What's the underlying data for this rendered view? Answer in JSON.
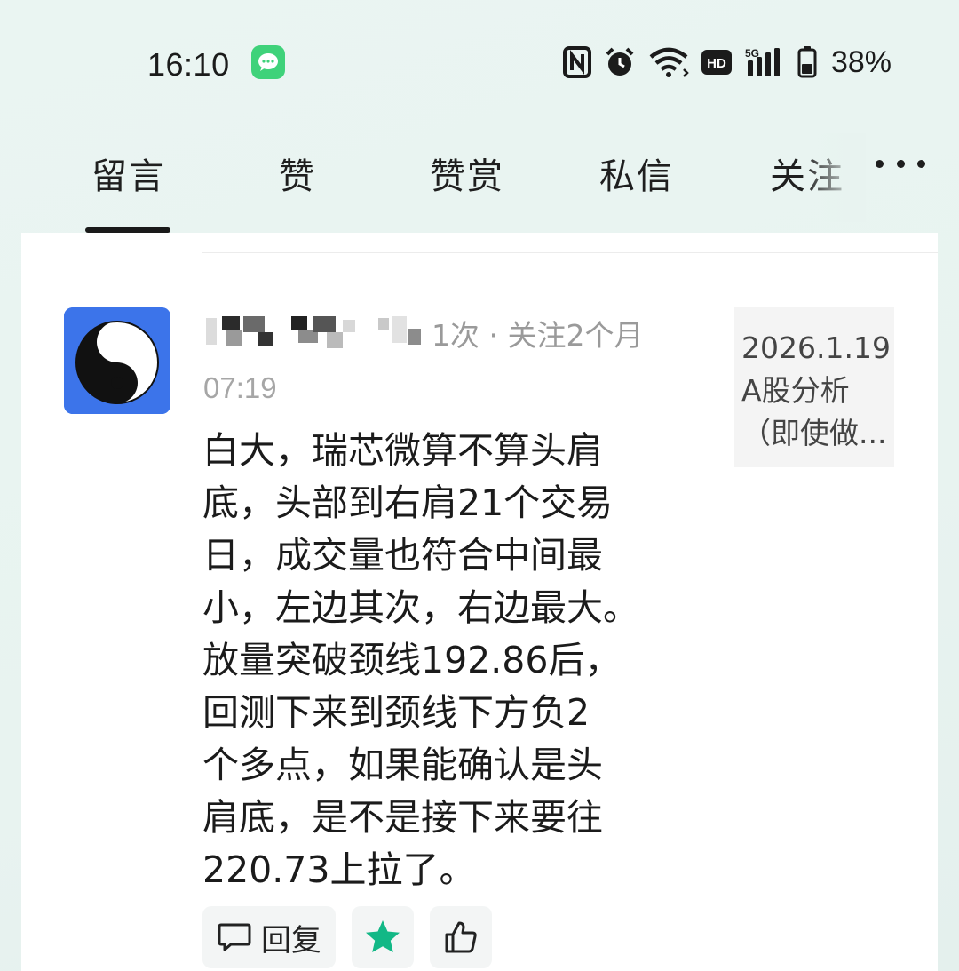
{
  "status_bar": {
    "time": "16:10",
    "battery_percent": "38%",
    "icons": [
      "message-app-icon",
      "nfc-icon",
      "alarm-icon",
      "wifi-icon",
      "hd-icon",
      "5g-signal-icon",
      "battery-icon"
    ],
    "accent_green": "#3fd27a"
  },
  "tabs": [
    {
      "label": "留言",
      "active": true
    },
    {
      "label": "赞",
      "active": false
    },
    {
      "label": "赞赏",
      "active": false
    },
    {
      "label": "私信",
      "active": false
    },
    {
      "label": "关注",
      "active": false
    }
  ],
  "comment": {
    "meta_suffix": "1次 · 关注2个月",
    "time": "07:19",
    "body_lines": [
      "白大，瑞芯微算不算头肩",
      "底，头部到右肩21个交易",
      "日，成交量也符合中间最",
      "小，左边其次，右边最大。",
      "放量突破颈线192.86后，",
      "回测下来到颈线下方负2",
      "个多点，如果能确认是头",
      "肩底，是不是接下来要往",
      "220.73上拉了。"
    ],
    "avatar_bg": "#3c74ea"
  },
  "article_preview": {
    "lines": [
      "2026.1.19",
      "A股分析",
      "（即使做..."
    ]
  },
  "actions": {
    "reply_label": "回复",
    "star_color": "#12b886"
  }
}
